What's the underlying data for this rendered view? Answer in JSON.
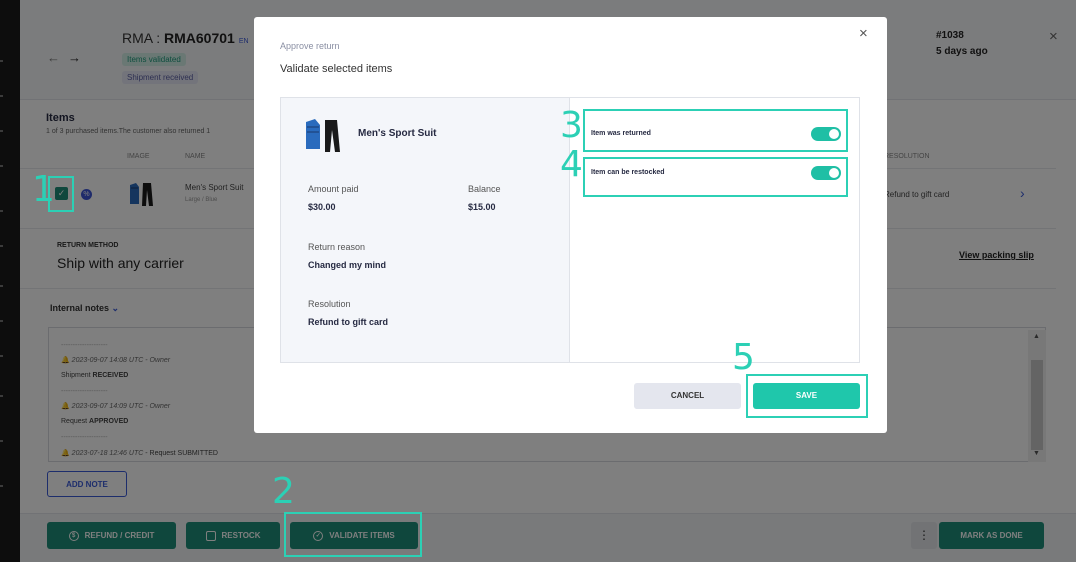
{
  "header": {
    "rma_prefix": "RMA : ",
    "rma_number": "RMA60701",
    "lang": "EN",
    "status_badges": [
      "Items validated",
      "Shipment received"
    ],
    "order_number": "#1038",
    "order_age": "5 days ago"
  },
  "items": {
    "title": "Items",
    "subtitle": "1 of 3 purchased items.The customer also returned 1",
    "columns": [
      "IMAGE",
      "NAME",
      "RESOLUTION"
    ],
    "row": {
      "name": "Men's Sport Suit",
      "variant": "Large / Blue",
      "resolution": "Refund to gift card"
    }
  },
  "return_method": {
    "label": "RETURN METHOD",
    "value": "Ship with any carrier",
    "packing_slip": "View packing slip"
  },
  "notes": {
    "title": "Internal notes",
    "entries": [
      {
        "time": "2023-09-07 14:08 UTC",
        "who": "- Owner",
        "text_prefix": "Shipment",
        "text_bold": "RECEIVED"
      },
      {
        "time": "2023-09-07 14:09 UTC",
        "who": "- Owner",
        "text_prefix": "Request",
        "text_bold": "APPROVED"
      },
      {
        "time": "2023-07-18 12:46 UTC",
        "who": "- Request SUBMITTED",
        "text_prefix": "",
        "text_bold": ""
      }
    ],
    "separator": "--------------------",
    "add_note": "ADD NOTE"
  },
  "footer": {
    "refund": "REFUND / CREDIT",
    "restock": "RESTOCK",
    "validate": "VALIDATE ITEMS",
    "more": "⋮",
    "mark_done": "MARK AS DONE"
  },
  "modal": {
    "subtitle": "Approve return",
    "title": "Validate selected items",
    "product_name": "Men's Sport Suit",
    "amount_paid_label": "Amount paid",
    "amount_paid": "$30.00",
    "balance_label": "Balance",
    "balance": "$15.00",
    "reason_label": "Return reason",
    "reason": "Changed my mind",
    "resolution_label": "Resolution",
    "resolution": "Refund to gift card",
    "toggle_returned": "Item was returned",
    "toggle_restocked": "Item can be restocked",
    "returned_on": true,
    "restocked_on": true,
    "cancel": "CANCEL",
    "save": "SAVE",
    "close": "×"
  },
  "annotations": [
    "1",
    "2",
    "3",
    "4",
    "5"
  ],
  "colors": {
    "accent": "#1fc7ab",
    "annotation": "#2cd0b5",
    "footer_button": "#1e8f7a",
    "link": "#3b5bd9"
  }
}
